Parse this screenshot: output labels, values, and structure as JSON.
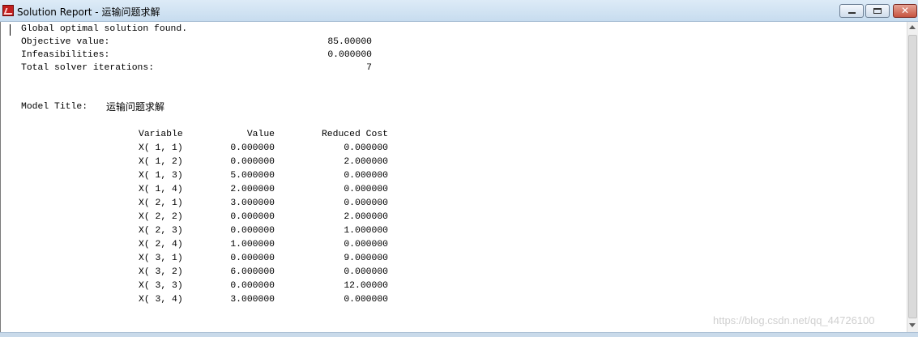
{
  "window": {
    "title": "Solution Report - 运输问题求解",
    "close_glyph": "✕"
  },
  "report": {
    "status": "Global optimal solution found.",
    "objective_label": "Objective value:",
    "objective_value": "85.00000",
    "infeasibilities_label": "Infeasibilities:",
    "infeasibilities_value": "0.000000",
    "iterations_label": "Total solver iterations:",
    "iterations_value": "7",
    "model_title_label": "Model Title:",
    "model_title_value": "运输问题求解"
  },
  "table": {
    "headers": [
      "Variable",
      "Value",
      "Reduced Cost"
    ],
    "rows": [
      [
        "X( 1, 1)",
        "0.000000",
        "0.000000"
      ],
      [
        "X( 1, 2)",
        "0.000000",
        "2.000000"
      ],
      [
        "X( 1, 3)",
        "5.000000",
        "0.000000"
      ],
      [
        "X( 1, 4)",
        "2.000000",
        "0.000000"
      ],
      [
        "X( 2, 1)",
        "3.000000",
        "0.000000"
      ],
      [
        "X( 2, 2)",
        "0.000000",
        "2.000000"
      ],
      [
        "X( 2, 3)",
        "0.000000",
        "1.000000"
      ],
      [
        "X( 2, 4)",
        "1.000000",
        "0.000000"
      ],
      [
        "X( 3, 1)",
        "0.000000",
        "9.000000"
      ],
      [
        "X( 3, 2)",
        "6.000000",
        "0.000000"
      ],
      [
        "X( 3, 3)",
        "0.000000",
        "12.00000"
      ],
      [
        "X( 3, 4)",
        "3.000000",
        "0.000000"
      ]
    ]
  },
  "watermark": "https://blog.csdn.net/qq_44726100",
  "icons": {
    "app": "lingo-app-icon",
    "minimize": "minimize-icon",
    "maximize": "maximize-icon",
    "close": "close-icon"
  }
}
